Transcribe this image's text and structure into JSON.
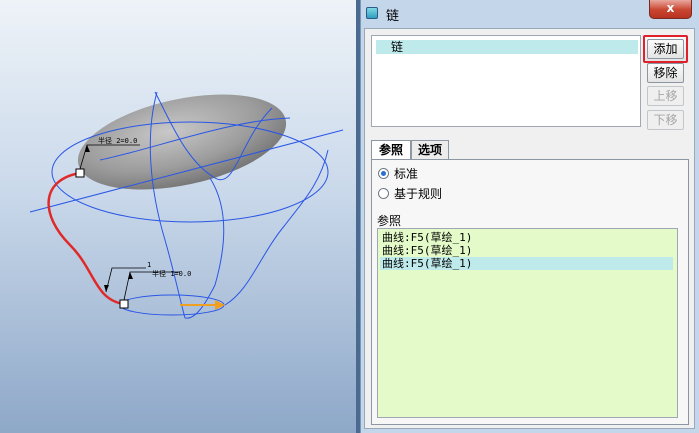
{
  "viewport": {
    "annotation_top": "半径 2=0.0",
    "annotation_bottom": "半径 1=0.0",
    "annotation_index": "1",
    "colors": {
      "curve": "#2a56e6",
      "selected_curve": "#e02a2a",
      "surface": "#9a9a9a",
      "arrow": "#f0a020"
    }
  },
  "dialog": {
    "title": "链",
    "close_glyph": "x",
    "chain_list": {
      "items": [
        "链"
      ]
    },
    "buttons": {
      "add": "添加",
      "remove": "移除",
      "move_up": "上移",
      "move_down": "下移"
    },
    "tabs": {
      "references": "参照",
      "options": "选项"
    },
    "type_options": {
      "standard": "标准",
      "rule_based": "基于规则"
    },
    "references_label": "参照",
    "references": [
      "曲线:F5(草绘_1)",
      "曲线:F5(草绘_1)",
      "曲线:F5(草绘_1)"
    ],
    "selected_reference_index": 2,
    "highlight_color": "#e0202a"
  }
}
